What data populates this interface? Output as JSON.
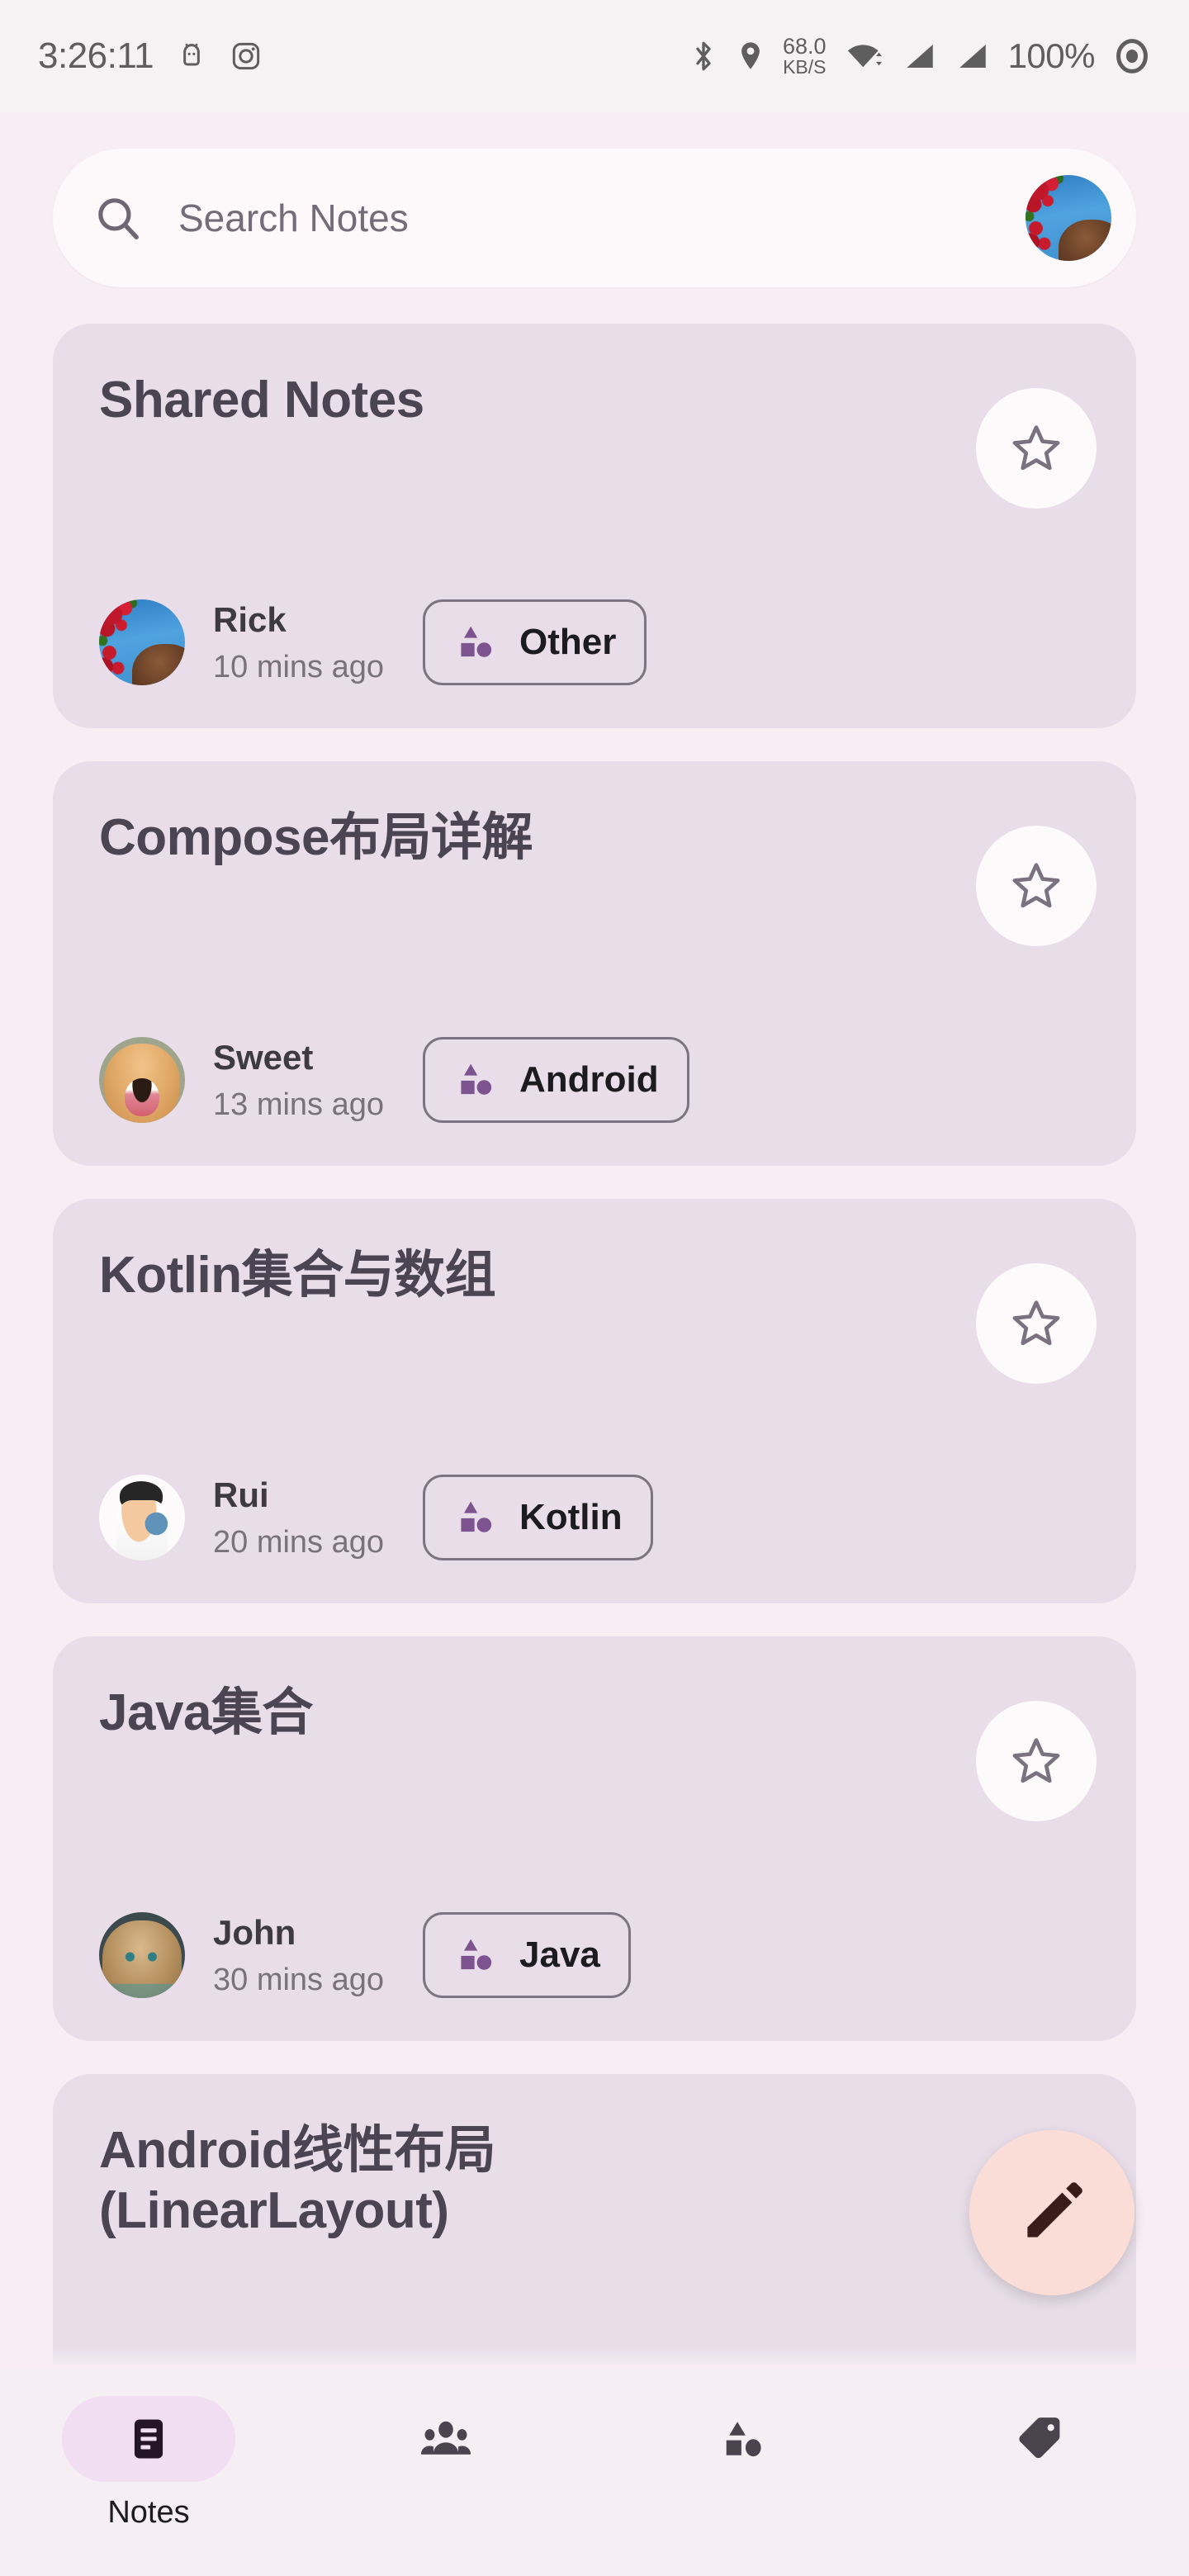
{
  "statusbar": {
    "time": "3:26:11",
    "network_speed_value": "68.0",
    "network_speed_unit": "KB/S",
    "battery": "100%",
    "icons": [
      "android-robot-icon",
      "instagram-icon",
      "bluetooth-icon",
      "location-icon",
      "wifi-icon",
      "signal-icon",
      "signal-icon",
      "battery-icon"
    ],
    "text_color": "#5E5E5E",
    "background": "#F5F2F4"
  },
  "search": {
    "placeholder": "Search Notes",
    "icon": "search-icon",
    "avatar": "profile-avatar",
    "background": "#FDF9FB"
  },
  "theme": {
    "page_background": "#F7EDF2",
    "card_background": "#E8DDE8",
    "title_color": "#4A4453",
    "accent_purple": "#7D5490",
    "fab_background": "#FADDD6",
    "fab_icon_color": "#3A1D1B",
    "nav_active_pill": "#F1DEF3",
    "nav_icon_color": "#4A444F"
  },
  "notes": [
    {
      "title": "Shared Notes",
      "author": "Rick",
      "time": "10 mins ago",
      "tag": "Other",
      "avatar_class": "av-rick",
      "starred": false
    },
    {
      "title": "Compose布局详解",
      "author": "Sweet",
      "time": "13 mins ago",
      "tag": "Android",
      "avatar_class": "av-sweet",
      "starred": false
    },
    {
      "title": "Kotlin集合与数组",
      "author": "Rui",
      "time": "20 mins ago",
      "tag": "Kotlin",
      "avatar_class": "av-rui",
      "starred": false
    },
    {
      "title": "Java集合",
      "author": "John",
      "time": "30 mins ago",
      "tag": "Java",
      "avatar_class": "av-john",
      "starred": false
    },
    {
      "title": "Android线性布局(LinearLayout)",
      "author": "",
      "time": "",
      "tag": "",
      "avatar_class": "",
      "starred": false
    }
  ],
  "fab": {
    "icon": "pencil-edit-icon",
    "label": "Create note"
  },
  "bottom_nav": {
    "items": [
      {
        "label": "Notes",
        "icon": "notes-document-icon",
        "active": true
      },
      {
        "label": "",
        "icon": "people-group-icon",
        "active": false
      },
      {
        "label": "",
        "icon": "shapes-category-icon",
        "active": false
      },
      {
        "label": "",
        "icon": "tag-label-icon",
        "active": false
      }
    ]
  }
}
